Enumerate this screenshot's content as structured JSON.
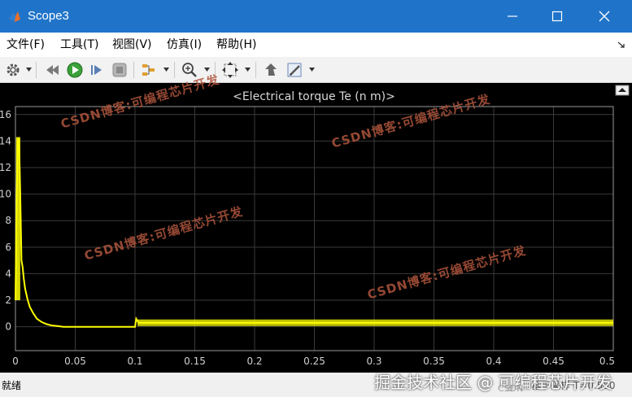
{
  "window": {
    "title": "Scope3",
    "colors": {
      "titlebar": "#1f74c9",
      "plot_bg": "#000000",
      "trace": "#ffff00",
      "grid": "#3a3a3a"
    }
  },
  "menu": {
    "items": [
      {
        "label": "文件(F)"
      },
      {
        "label": "工具(T)"
      },
      {
        "label": "视图(V)"
      },
      {
        "label": "仿真(I)"
      },
      {
        "label": "帮助(H)"
      }
    ]
  },
  "toolbar": {
    "icons": [
      "gear-icon",
      "restore-icon",
      "run-icon",
      "step-forward-icon",
      "stop-icon",
      "highlight-icon",
      "zoom-icon",
      "autoscale-icon",
      "cursor-icon",
      "edit-icon"
    ]
  },
  "chart_data": {
    "type": "line",
    "title": "<Electrical torque Te (n m)>",
    "xlabel": "",
    "ylabel": "",
    "xlim": [
      0,
      0.5
    ],
    "ylim": [
      -1.8,
      16.6
    ],
    "xticks": [
      0,
      0.05,
      0.1,
      0.15,
      0.2,
      0.25,
      0.3,
      0.35,
      0.4,
      0.45,
      0.5
    ],
    "xtick_labels": [
      "0",
      "0.05",
      "0.1",
      "0.15",
      "0.2",
      "0.25",
      "0.3",
      "0.35",
      "0.4",
      "0.45",
      "0.5"
    ],
    "yticks": [
      0,
      2,
      4,
      6,
      8,
      10,
      12,
      14,
      16
    ],
    "ytick_labels": [
      "0",
      "2",
      "4",
      "6",
      "8",
      "10",
      "12",
      "14",
      "16"
    ],
    "grid": true,
    "series": [
      {
        "color": "#ffff00",
        "x": [
          0,
          0.001,
          0.002,
          0.003,
          0.004,
          0.005,
          0.006,
          0.007,
          0.008,
          0.01,
          0.012,
          0.015,
          0.018,
          0.022,
          0.026,
          0.03,
          0.035,
          0.04,
          0.05,
          0.06,
          0.08,
          0.1,
          0.101,
          0.103,
          0.15,
          0.2,
          0.25,
          0.3,
          0.35,
          0.4,
          0.45,
          0.5
        ],
        "y": [
          2,
          10,
          14,
          14.2,
          10,
          5,
          4.5,
          3.6,
          2.9,
          2.1,
          1.5,
          1.0,
          0.6,
          0.35,
          0.2,
          0.1,
          0.05,
          0,
          0,
          0,
          0,
          0,
          0.6,
          0.3,
          0.3,
          0.3,
          0.3,
          0.3,
          0.3,
          0.3,
          0.3,
          0.3
        ]
      }
    ]
  },
  "watermarks": [
    "CSDN博客:可编程芯片开发",
    "CSDN博客:可编程芯片开发",
    "CSDN博客:可编程芯片开发",
    "CSDN博客:可编程芯片开发"
  ],
  "status": {
    "left": "就绪",
    "right": "基于采样  T=0.500"
  },
  "site_watermark": "掘金技术社区 @ 可编程芯片开发",
  "site_watermark_sub": "CSDN"
}
